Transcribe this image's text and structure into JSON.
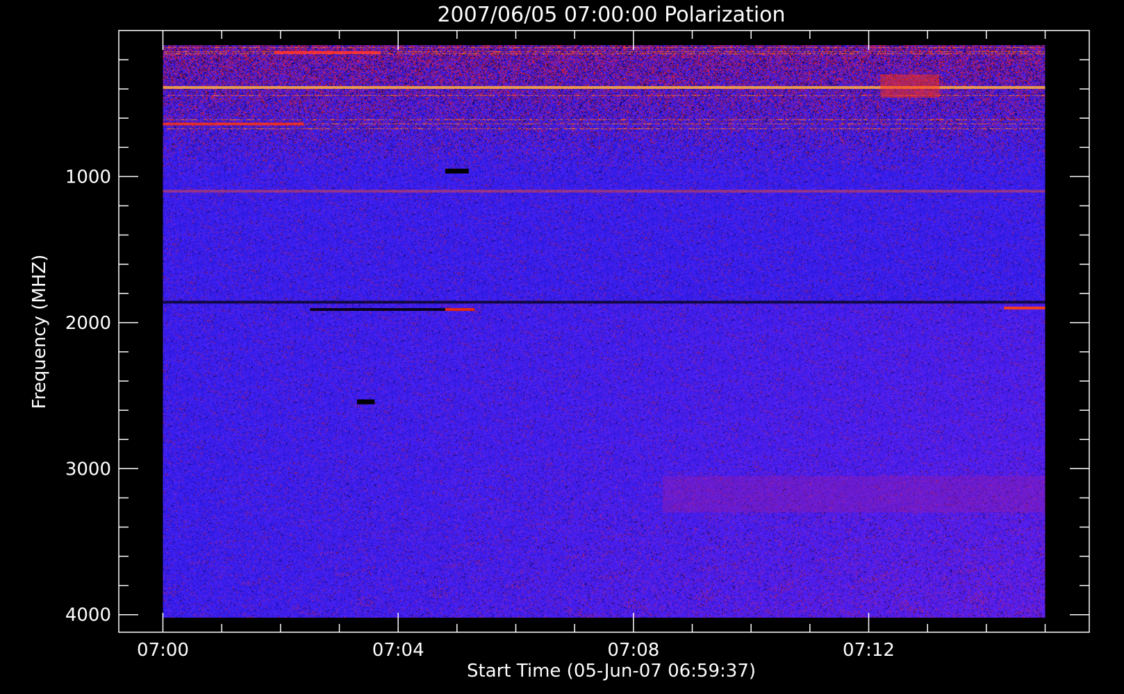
{
  "chart_data": {
    "type": "heatmap",
    "title": "2007/06/05 07:00:00 Polarization",
    "xlabel": "Start Time (05-Jun-07 06:59:37)",
    "ylabel": "Frequency (MHZ)",
    "x_ticks": [
      "07:00",
      "07:04",
      "07:08",
      "07:12"
    ],
    "x_tick_minutes": [
      0,
      4,
      8,
      12
    ],
    "x_data_range_minutes": [
      0,
      15
    ],
    "x_axis_range_minutes": [
      -0.75,
      15.75
    ],
    "y_ticks": [
      "1000",
      "2000",
      "3000",
      "4000"
    ],
    "y_tick_values": [
      1000,
      2000,
      3000,
      4000
    ],
    "y_data_range": [
      100,
      4020
    ],
    "y_axis_range": [
      0,
      4120
    ],
    "y_inverted": true,
    "grid": false,
    "colors": {
      "background": "#000000",
      "axes": "#ffffff",
      "base": "#2a1cf0",
      "positive": "#ff2a10",
      "strong": "#ff9a20",
      "negative": "#000000"
    },
    "features": [
      {
        "kind": "band",
        "freq": 390,
        "t_start": 0,
        "t_end": 15,
        "color": "#ffb040",
        "intensity": 0.85
      },
      {
        "kind": "band",
        "freq": 1860,
        "t_start": 0,
        "t_end": 15,
        "color": "#000000",
        "intensity": 0.7
      },
      {
        "kind": "band",
        "freq": 1910,
        "t_start": 2.5,
        "t_end": 5.3,
        "color": "#000000",
        "intensity": 0.9
      },
      {
        "kind": "band",
        "freq": 1900,
        "t_start": 14.3,
        "t_end": 15,
        "color": "#ff4010",
        "intensity": 0.95
      },
      {
        "kind": "band",
        "freq": 1910,
        "t_start": 4.8,
        "t_end": 5.3,
        "color": "#ff3010",
        "intensity": 0.9
      },
      {
        "kind": "band",
        "freq": 1100,
        "t_start": 0,
        "t_end": 15,
        "color": "#ff5020",
        "intensity": 0.45
      },
      {
        "kind": "band",
        "freq": 150,
        "t_start": 1.9,
        "t_end": 3.7,
        "color": "#ff3030",
        "intensity": 0.95
      },
      {
        "kind": "band",
        "freq": 640,
        "t_start": 0,
        "t_end": 2.4,
        "color": "#ff3010",
        "intensity": 0.8
      },
      {
        "kind": "block",
        "freq": 960,
        "t_start": 4.8,
        "t_end": 5.2,
        "color": "#000000"
      },
      {
        "kind": "block",
        "freq": 2540,
        "t_start": 3.3,
        "t_end": 3.6,
        "color": "#000000"
      },
      {
        "kind": "region",
        "freq_start": 3050,
        "freq_end": 3300,
        "t_start": 8.5,
        "t_end": 15,
        "color": "#a01aa0",
        "intensity": 0.35
      },
      {
        "kind": "region",
        "freq_start": 300,
        "freq_end": 460,
        "t_start": 12.2,
        "t_end": 13.2,
        "color": "#ff3010",
        "intensity": 0.5
      }
    ]
  }
}
